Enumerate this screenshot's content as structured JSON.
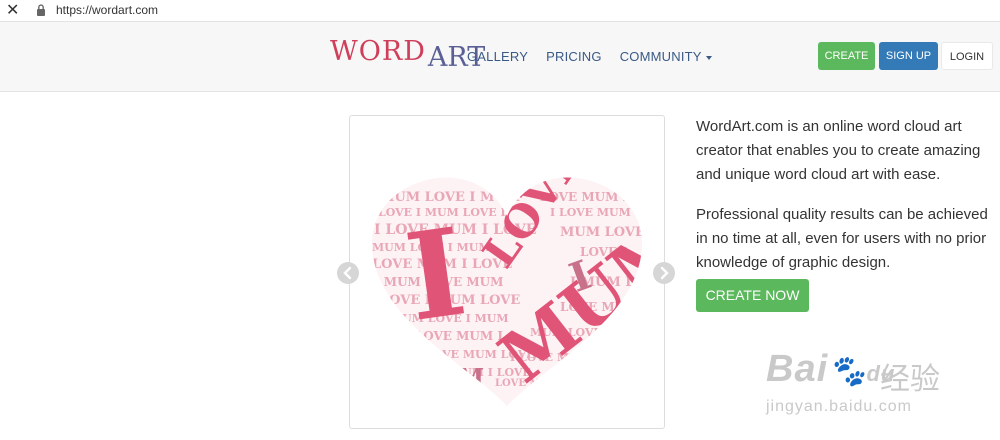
{
  "browser": {
    "url": "https://wordart.com"
  },
  "header": {
    "logo_word": "WORD",
    "logo_art": "ART",
    "nav": [
      "GALLERY",
      "PRICING",
      "COMMUNITY"
    ],
    "create_label": "CREATE",
    "signup_label": "SIGN UP",
    "login_label": "LOGIN"
  },
  "carousel": {
    "heart_words": [
      "I",
      "LOVE",
      "MUM"
    ]
  },
  "intro": {
    "paragraph1": "WordArt.com is an online word cloud art creator that enables you to create amazing and unique word cloud art with ease.",
    "paragraph2": "Professional quality results can be achieved in no time at all, even for users with no prior knowledge of graphic design.",
    "cta_label": "CREATE NOW"
  },
  "watermark": {
    "brand": "Bai",
    "brand2": "du",
    "cn": "经验",
    "sub": "jingyan.baidu.com"
  },
  "colors": {
    "green": "#5cb85c",
    "blue": "#337ab7",
    "heart_pink": "#e05577",
    "heart_light": "#e9a6b6"
  }
}
